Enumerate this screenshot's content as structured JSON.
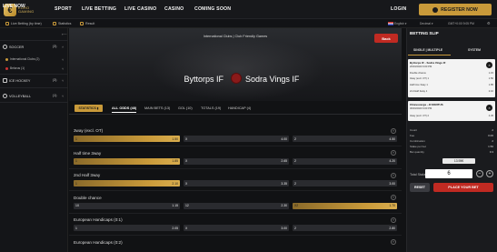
{
  "brand": {
    "logo_text": "EURO\nGAMING",
    "accent": "#c99a3a",
    "danger": "#c02a22"
  },
  "topnav": {
    "items": [
      "SPORT",
      "LIVE BETTING",
      "LIVE CASINO",
      "CASINO",
      "COMING SOON"
    ],
    "login": "LOGIN",
    "register": "REGISTER NOW"
  },
  "subnav": {
    "left": [
      "Live Betting (by time)",
      "Statistics",
      "Result"
    ],
    "language": "English",
    "odds_format": "Decimal",
    "clock": "GMT+0:00 9:05 PM"
  },
  "sidebar": {
    "title": "LIVE NOW",
    "sports": [
      {
        "name": "SOCCER",
        "count": "(3)"
      },
      {
        "name": "ICE HOCKEY",
        "count": "(3)"
      },
      {
        "name": "VOLLEYBALL",
        "count": "(1)"
      }
    ],
    "soccer_subs": [
      {
        "name": "International Clubs (2)",
        "count": "(2)"
      },
      {
        "name": "Belarus (1)",
        "count": "(1)"
      }
    ]
  },
  "event": {
    "back_label": "Back",
    "competition": "International Clubs | Club Friendly Games",
    "team1": "Byttorps IF",
    "team2": "Sodra Vings IF"
  },
  "tabs": {
    "statistics": "STATISTICS",
    "items": [
      "ALL ODDS (48)",
      "MAIN BETS (13)",
      "GOL (10)",
      "TOTALS (19)",
      "HANDICAP (4)"
    ]
  },
  "markets": [
    {
      "title": "3way (excl. OT)",
      "odds": [
        {
          "l": "1",
          "v": "1.50",
          "g": true
        },
        {
          "l": "X",
          "v": "4.00",
          "g": false
        },
        {
          "l": "2",
          "v": "4.50",
          "g": false
        }
      ]
    },
    {
      "title": "Half time 3way",
      "odds": [
        {
          "l": "1",
          "v": "1.85",
          "g": true
        },
        {
          "l": "X",
          "v": "2.65",
          "g": false
        },
        {
          "l": "2",
          "v": "4.20",
          "g": false
        }
      ]
    },
    {
      "title": "2nd Half 3way",
      "odds": [
        {
          "l": "1",
          "v": "2.10",
          "g": true
        },
        {
          "l": "X",
          "v": "3.35",
          "g": false
        },
        {
          "l": "2",
          "v": "3.00",
          "g": false
        }
      ]
    },
    {
      "title": "Double chance",
      "odds": [
        {
          "l": "1X",
          "v": "1.15",
          "g": false
        },
        {
          "l": "12",
          "v": "2.30",
          "g": false
        },
        {
          "l": "X2",
          "v": "1.70",
          "g": true
        }
      ]
    },
    {
      "title": "European Handicaps (0:1)",
      "odds": [
        {
          "l": "1",
          "v": "2.05",
          "g": false
        },
        {
          "l": "X",
          "v": "3.00",
          "g": false
        },
        {
          "l": "2",
          "v": "2.80",
          "g": false
        }
      ]
    },
    {
      "title": "European Handicaps (0:2)",
      "odds": []
    }
  ],
  "slip": {
    "title": "BETTING SLIP",
    "tab_single": "SINGLE | MULTIPLE",
    "tab_system": "SYSTEM",
    "bets": [
      {
        "event": "Byttorps IF - Sodra Vings IF",
        "date": "20/03/2020 9:00 PM",
        "rows": [
          {
            "k": "Double chance",
            "v": "1.15"
          },
          {
            "k": "3way (excl. OT) 1",
            "v": "1.50"
          },
          {
            "k": "Half time 3way 1",
            "v": "1.85"
          },
          {
            "k": "2nd Half 3way 1",
            "v": "2.10"
          }
        ]
      },
      {
        "event": "Chievoverga - JUVENTUS",
        "date": "30/03/2020 9:00 PM",
        "rows": [
          {
            "k": "3way (excl. OT) 2",
            "v": "4.45"
          }
        ]
      }
    ],
    "summary": [
      {
        "k": "Count",
        "v": "2"
      },
      {
        "k": "Fee",
        "v": "0.00"
      },
      {
        "k": "Combination",
        "v": "2"
      },
      {
        "k": "Stake per bet",
        "v": "1.50"
      },
      {
        "k": "Bet quantity",
        "v": "9.3"
      }
    ],
    "stake_value": "13.95€",
    "total_stake_label": "Total Stake",
    "total_stake": "6",
    "reset": "RESET",
    "place": "PLACE YOUR BET"
  }
}
